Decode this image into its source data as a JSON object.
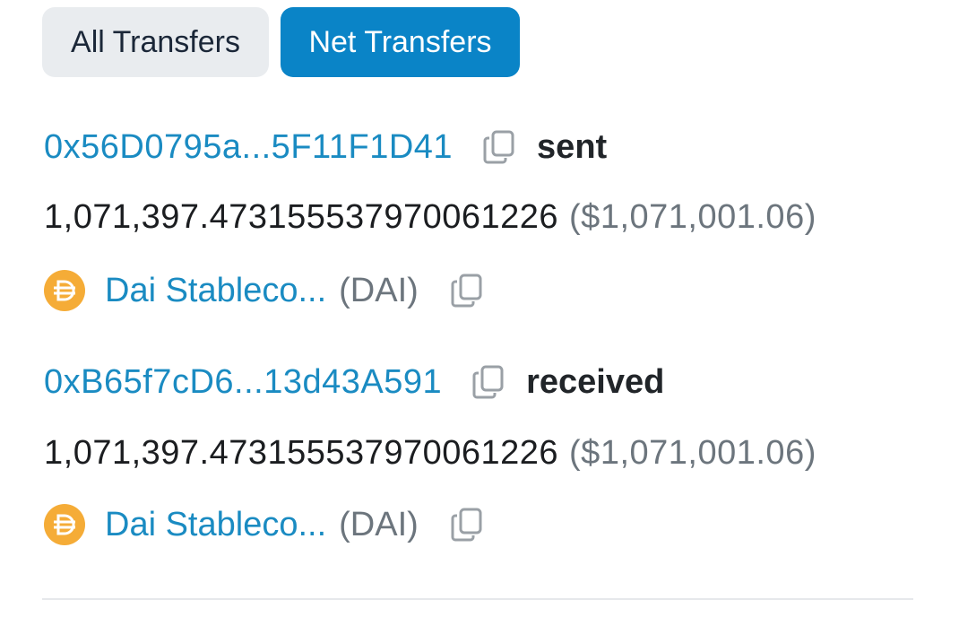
{
  "tabs": [
    {
      "label": "All Transfers",
      "active": false
    },
    {
      "label": "Net Transfers",
      "active": true
    }
  ],
  "transfers": [
    {
      "address": "0x56D0795a...5F11F1D41",
      "direction": "sent",
      "amount": "1,071,397.473155537970061226",
      "usd": "($1,071,001.06)",
      "token": {
        "name": "Dai Stableco...",
        "symbol": "(DAI)",
        "icon": "dai-token-icon"
      }
    },
    {
      "address": "0xB65f7cD6...13d43A591",
      "direction": "received",
      "amount": "1,071,397.473155537970061226",
      "usd": "($1,071,001.06)",
      "token": {
        "name": "Dai Stableco...",
        "symbol": "(DAI)",
        "icon": "dai-token-icon"
      }
    }
  ],
  "colors": {
    "accent": "#0a84c7",
    "link": "#1a8bc2",
    "muted": "#6c757d",
    "dai": "#f5ac37"
  }
}
